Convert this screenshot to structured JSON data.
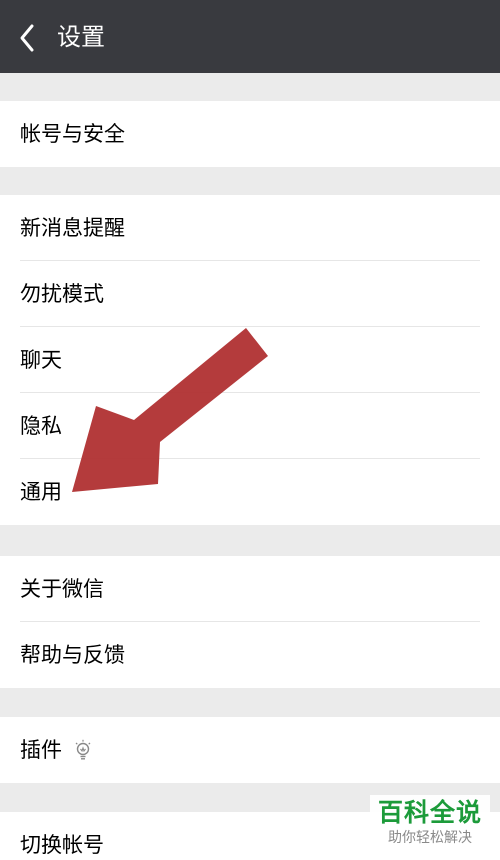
{
  "header": {
    "title": "设置",
    "back_icon": "chevron-left-icon"
  },
  "groups": [
    {
      "items": [
        {
          "label": "帐号与安全"
        }
      ]
    },
    {
      "items": [
        {
          "label": "新消息提醒"
        },
        {
          "label": "勿扰模式"
        },
        {
          "label": "聊天"
        },
        {
          "label": "隐私"
        },
        {
          "label": "通用"
        }
      ]
    },
    {
      "items": [
        {
          "label": "关于微信"
        },
        {
          "label": "帮助与反馈"
        }
      ]
    },
    {
      "items": [
        {
          "label": "插件",
          "icon": "lightbulb-icon"
        }
      ]
    },
    {
      "items": [
        {
          "label": "切换帐号"
        }
      ]
    }
  ],
  "annotation": {
    "icon": "red-arrow-pointer",
    "color": "#b03032"
  },
  "watermark": {
    "title": "百科全说",
    "subtitle": "助你轻松解决"
  },
  "colors": {
    "topbar": "#393a3f",
    "background": "#ebebeb",
    "row": "#ffffff"
  }
}
